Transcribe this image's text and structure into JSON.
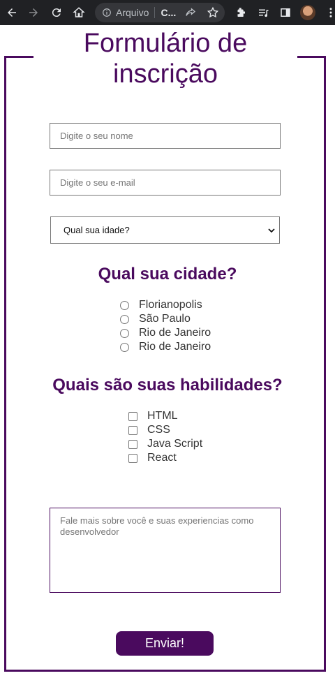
{
  "browser": {
    "address_security_label": "Arquivo",
    "address_host": "C...",
    "colors": {
      "toolbar_bg": "#202124",
      "omnibox_bg": "#35363a"
    }
  },
  "page": {
    "title": "Formulário de inscrição",
    "accent_color": "#4a0a5e",
    "name_input": {
      "placeholder": "Digite o seu nome",
      "value": ""
    },
    "email_input": {
      "placeholder": "Digite o seu e-mail",
      "value": ""
    },
    "age_select": {
      "selected": "Qual sua idade?"
    },
    "city_section": {
      "title": "Qual sua cidade?",
      "options": [
        "Florianopolis",
        "São Paulo",
        "Rio de Janeiro",
        "Rio de Janeiro"
      ]
    },
    "skills_section": {
      "title": "Quais são suas habilidades?",
      "options": [
        "HTML",
        "CSS",
        "Java Script",
        "React"
      ]
    },
    "about_textarea": {
      "placeholder": "Fale mais sobre você e suas experiencias como desenvolvedor"
    },
    "submit_label": "Enviar!"
  }
}
